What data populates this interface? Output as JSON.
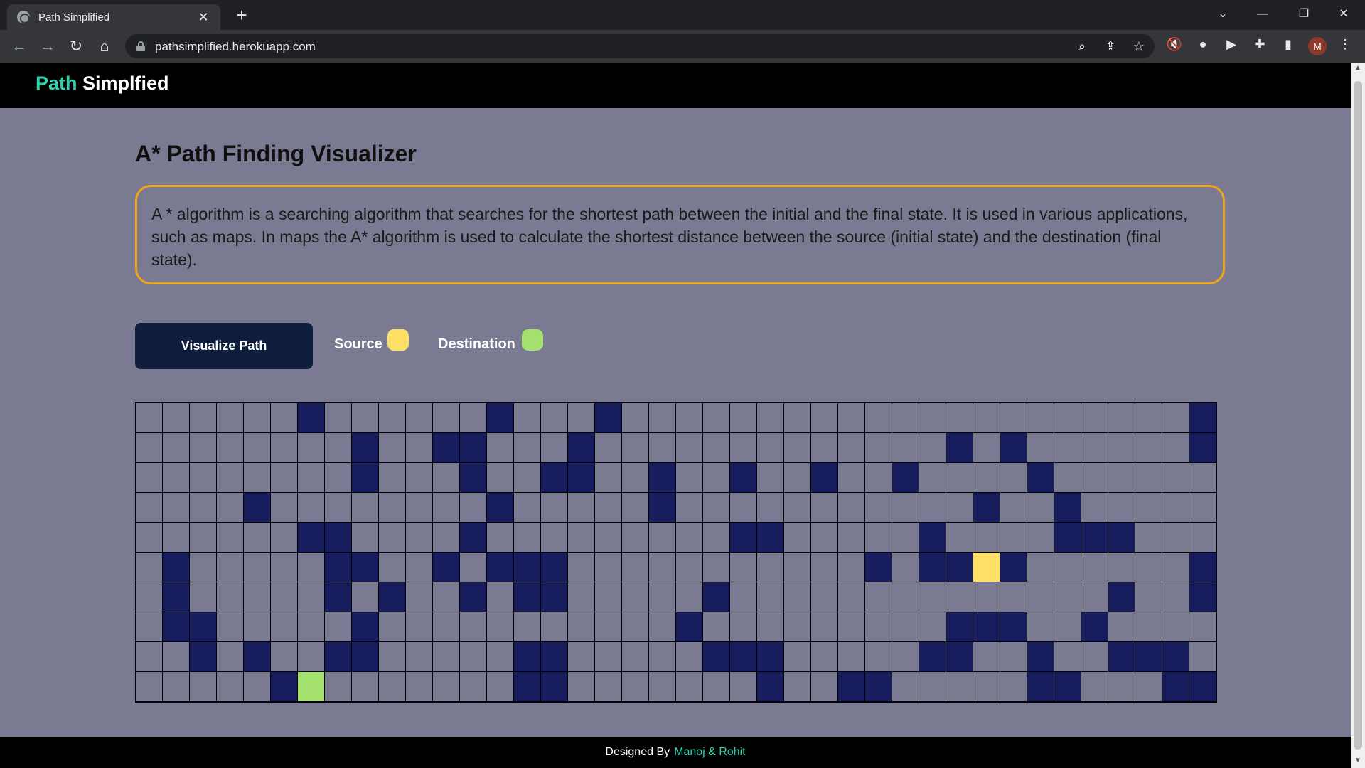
{
  "browser": {
    "tab_title": "Path Simplified",
    "url": "pathsimplified.herokuapp.com",
    "profile_initial": "M"
  },
  "header": {
    "brand_accent": "Path",
    "brand_rest": " Simplfied"
  },
  "main": {
    "title": "A* Path Finding Visualizer",
    "description": "A * algorithm is a searching algorithm that searches for the shortest path between the initial and the final state. It is used in various applications, such as maps. In maps the A* algorithm is used to calculate the shortest distance between the source (initial state) and the destination (final state).",
    "visualize_button": "Visualize Path",
    "legend_source": "Source",
    "legend_destination": "Destination"
  },
  "colors": {
    "background": "#7a7b92",
    "wall": "#161c5c",
    "source": "#ffe066",
    "destination": "#a3e06e",
    "accent": "#2ed3b0",
    "description_border": "#f0a418"
  },
  "grid": {
    "cols": 40,
    "rows": 10,
    "walls": [
      [
        0,
        6
      ],
      [
        0,
        13
      ],
      [
        0,
        17
      ],
      [
        0,
        39
      ],
      [
        1,
        8
      ],
      [
        1,
        11
      ],
      [
        1,
        12
      ],
      [
        1,
        16
      ],
      [
        1,
        30
      ],
      [
        1,
        32
      ],
      [
        1,
        39
      ],
      [
        2,
        8
      ],
      [
        2,
        12
      ],
      [
        2,
        15
      ],
      [
        2,
        16
      ],
      [
        2,
        19
      ],
      [
        2,
        22
      ],
      [
        2,
        25
      ],
      [
        2,
        28
      ],
      [
        2,
        33
      ],
      [
        3,
        4
      ],
      [
        3,
        13
      ],
      [
        3,
        19
      ],
      [
        3,
        31
      ],
      [
        3,
        34
      ],
      [
        4,
        6
      ],
      [
        4,
        7
      ],
      [
        4,
        12
      ],
      [
        4,
        22
      ],
      [
        4,
        23
      ],
      [
        4,
        29
      ],
      [
        4,
        34
      ],
      [
        4,
        35
      ],
      [
        4,
        36
      ],
      [
        5,
        1
      ],
      [
        5,
        7
      ],
      [
        5,
        8
      ],
      [
        5,
        11
      ],
      [
        5,
        13
      ],
      [
        5,
        14
      ],
      [
        5,
        15
      ],
      [
        5,
        27
      ],
      [
        5,
        29
      ],
      [
        5,
        30
      ],
      [
        5,
        32
      ],
      [
        5,
        39
      ],
      [
        6,
        1
      ],
      [
        6,
        7
      ],
      [
        6,
        9
      ],
      [
        6,
        12
      ],
      [
        6,
        14
      ],
      [
        6,
        15
      ],
      [
        6,
        21
      ],
      [
        6,
        36
      ],
      [
        6,
        39
      ],
      [
        7,
        1
      ],
      [
        7,
        2
      ],
      [
        7,
        8
      ],
      [
        7,
        20
      ],
      [
        7,
        30
      ],
      [
        7,
        31
      ],
      [
        7,
        32
      ],
      [
        7,
        35
      ],
      [
        8,
        2
      ],
      [
        8,
        4
      ],
      [
        8,
        7
      ],
      [
        8,
        8
      ],
      [
        8,
        14
      ],
      [
        8,
        15
      ],
      [
        8,
        21
      ],
      [
        8,
        22
      ],
      [
        8,
        23
      ],
      [
        8,
        29
      ],
      [
        8,
        30
      ],
      [
        8,
        33
      ],
      [
        8,
        36
      ],
      [
        8,
        37
      ],
      [
        8,
        38
      ],
      [
        9,
        5
      ],
      [
        9,
        14
      ],
      [
        9,
        15
      ],
      [
        9,
        23
      ],
      [
        9,
        26
      ],
      [
        9,
        27
      ],
      [
        9,
        33
      ],
      [
        9,
        34
      ],
      [
        9,
        38
      ],
      [
        9,
        39
      ]
    ],
    "source": [
      5,
      31
    ],
    "destination": [
      9,
      6
    ]
  },
  "footer": {
    "prefix": "Designed By",
    "authors": "Manoj & Rohit"
  }
}
